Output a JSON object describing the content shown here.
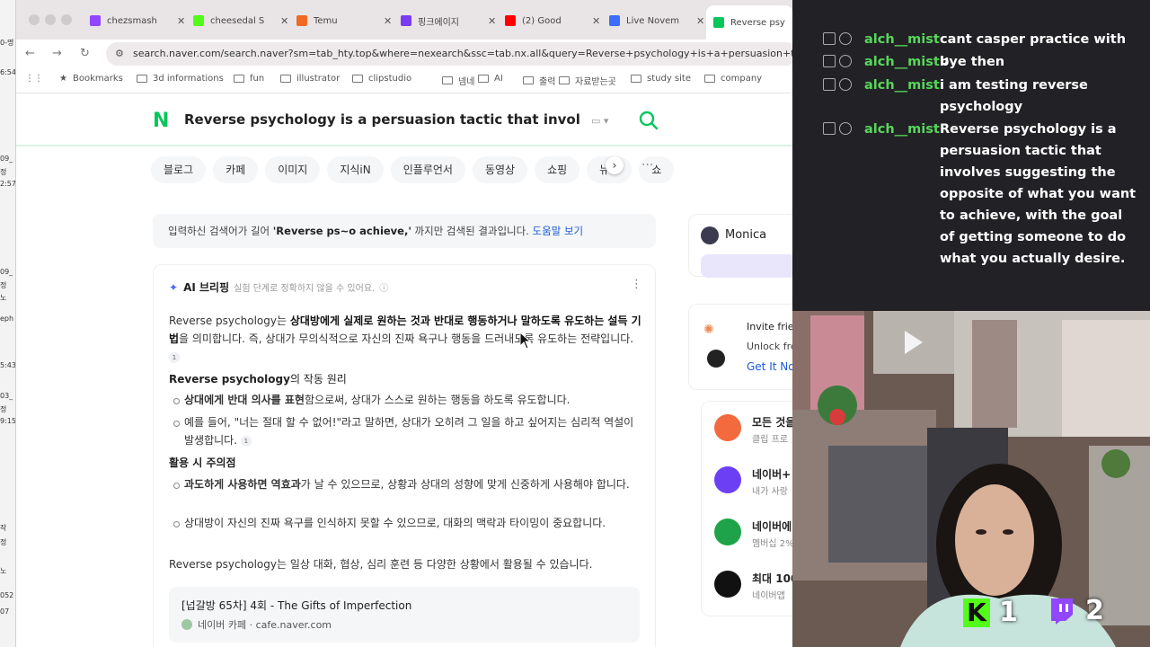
{
  "browser": {
    "tabs": [
      {
        "title": "chezsmash",
        "favicon": "twitch-icon",
        "color": "#9146ff"
      },
      {
        "title": "cheesedal S",
        "favicon": "kick-icon",
        "color": "#53fc18"
      },
      {
        "title": "Temu",
        "favicon": "temu-icon",
        "color": "#f06a25"
      },
      {
        "title": "핑크에이지",
        "favicon": "p-icon",
        "color": "#7a3cf0"
      },
      {
        "title": "(2) Good",
        "favicon": "youtube-icon",
        "color": "#ff0000"
      },
      {
        "title": "Live Novem",
        "favicon": "r-icon",
        "color": "#3d6dfc"
      },
      {
        "title": "Reverse psy",
        "favicon": "naver-icon",
        "color": "#03c75a"
      }
    ],
    "url": "search.naver.com/search.naver?sm=tab_hty.top&where=nexearch&ssc=tab.nx.all&query=Reverse+psychology+is+a+persuasion+tactic+that",
    "bookmarks": [
      "Bookmarks",
      "3d informations",
      "fun",
      "illustrator",
      "clipstudio",
      "넴네",
      "AI",
      "출력",
      "자료받는곳",
      "study site",
      "company"
    ]
  },
  "search": {
    "logo": "N",
    "query": "Reverse psychology is a persuasion tactic that involves suggesting the opposite",
    "categories": [
      "블로그",
      "카페",
      "이미지",
      "지식iN",
      "인플루언서",
      "동영상",
      "쇼핑",
      "뉴스",
      "쇼"
    ],
    "notice_pre": "입력하신 검색어가 길어 ",
    "notice_bold": "'Reverse ps~o achieve,'",
    "notice_post": " 까지만 검색된 결과입니다. ",
    "notice_link": "도움말 보기"
  },
  "briefing": {
    "title": "AI 브리핑",
    "subtitle": "실험 단계로 정확하지 않을 수 있어요.",
    "intro_a": "Reverse psychology는 ",
    "intro_b": "상대방에게 실제로 원하는 것과 반대로 행동하거나 말하도록 유도하는 설득 기법",
    "intro_c": "을 의미합니다. 즉, 상대가 무의식적으로 자신의 진짜 욕구나 행동을 드러내도록 유도하는 전략입니다.",
    "h1_a": "Reverse psychology",
    "h1_b": "의 작동 원리",
    "b1_bold": "상대에게 반대 의사를 표현",
    "b1_rest": "함으로써, 상대가 스스로 원하는 행동을 하도록 유도합니다.",
    "b2": "예를 들어, \"너는 절대 할 수 없어!\"라고 말하면, 상대가 오히려 그 일을 하고 싶어지는 심리적 역설이 발생합니다.",
    "h2": "활용 시 주의점",
    "b3_bold": "과도하게 사용하면 역효과",
    "b3_rest": "가 날 수 있으므로, 상황과 상대의 성향에 맞게 신중하게 사용해야 합니다.",
    "b4": "상대방이 자신의 진짜 욕구를 인식하지 못할 수 있으므로, 대화의 맥락과 타이밍이 중요합니다.",
    "outro_a": "Reverse psychology",
    "outro_b": "는 일상 대화, 협상, 심리 훈련 등 다양한 상황에서 활용될 수 있습니다.",
    "cite": "1",
    "source_title": "[넙갈방 65차] 4회 - The Gifts of Imperfection",
    "source_site": "네이버 카페",
    "source_domain": "cafe.naver.com"
  },
  "sidebar": {
    "monica": "Monica",
    "invite_title": "Invite frie",
    "invite_text": "Unlock fre",
    "invite_link": "Get It No",
    "services": [
      {
        "title": "모든 것을",
        "sub": "클립 프로",
        "color": "#f26a3d"
      },
      {
        "title": "네이버+",
        "sub": "내가 사랑",
        "color": "#6c3ff5"
      },
      {
        "title": "네이버에",
        "sub": "멤버십 2%",
        "color": "#1fa34a"
      },
      {
        "title": "최대 100",
        "sub": "네이버앱",
        "color": "#111111"
      }
    ]
  },
  "chat": {
    "messages": [
      {
        "user": "alch__mist",
        "text": "cant casper practice with u"
      },
      {
        "user": "alch__mist",
        "text": "bye then"
      },
      {
        "user": "alch__mist",
        "text": "i am testing reverse psychology"
      },
      {
        "user": "alch__mist",
        "text": "Reverse psychology is a persuasion tactic that involves suggesting the opposite of what you want to achieve, with the goal of getting someone to do what you actually desire."
      }
    ],
    "username_color": "#58d65b"
  },
  "overlay": {
    "kick_count": "1",
    "twitch_count": "2",
    "kick_logo": "K"
  },
  "left_window": {
    "snippets": [
      "0-명",
      "6:54",
      "09_",
      "정",
      "2:57",
      "09_",
      "정",
      "노",
      "eph",
      "5:43",
      "03_",
      "정",
      "9:15",
      "작",
      "정",
      "노",
      "052",
      "07"
    ]
  }
}
